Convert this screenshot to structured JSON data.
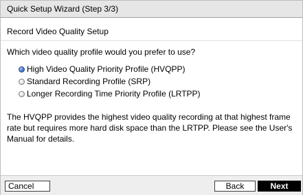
{
  "window": {
    "title": "Quick Setup Wizard (Step 3/3)"
  },
  "content": {
    "subtitle": "Record Video Quality Setup",
    "question": "Which video quality profile would you prefer to use?",
    "options": [
      {
        "label": "High Video Quality Priority Profile (HVQPP)",
        "selected": true
      },
      {
        "label": "Standard Recording Profile (SRP)",
        "selected": false
      },
      {
        "label": "Longer Recording Time Priority Profile (LRTPP)",
        "selected": false
      }
    ],
    "description": "The HVQPP provides the highest video quality recording at that highest frame rate but requires more hard disk space than the LRTPP. Please see the User's Manual for details."
  },
  "footer": {
    "cancel_label": "Cancel",
    "back_label": "Back",
    "next_label": "Next"
  },
  "colors": {
    "titlebar_bg": "#e6e6e6",
    "selected_radio": "#4b78c9",
    "next_button_bg": "#000000"
  }
}
